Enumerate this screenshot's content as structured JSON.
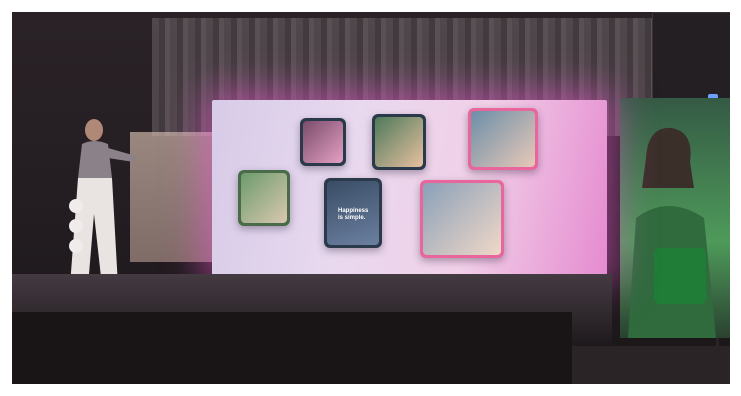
{
  "scene": {
    "description_tags": [
      "launch-event",
      "presenter",
      "led-screen",
      "stage"
    ],
    "screen": {
      "tagline": "Happiness\nis simple.",
      "caption": ""
    },
    "colors": {
      "screen_glow": "#ec5ad2",
      "banner_green": "#4e9a5a",
      "device_dark": "#2b3a4a",
      "device_pink": "#e8669c"
    }
  }
}
